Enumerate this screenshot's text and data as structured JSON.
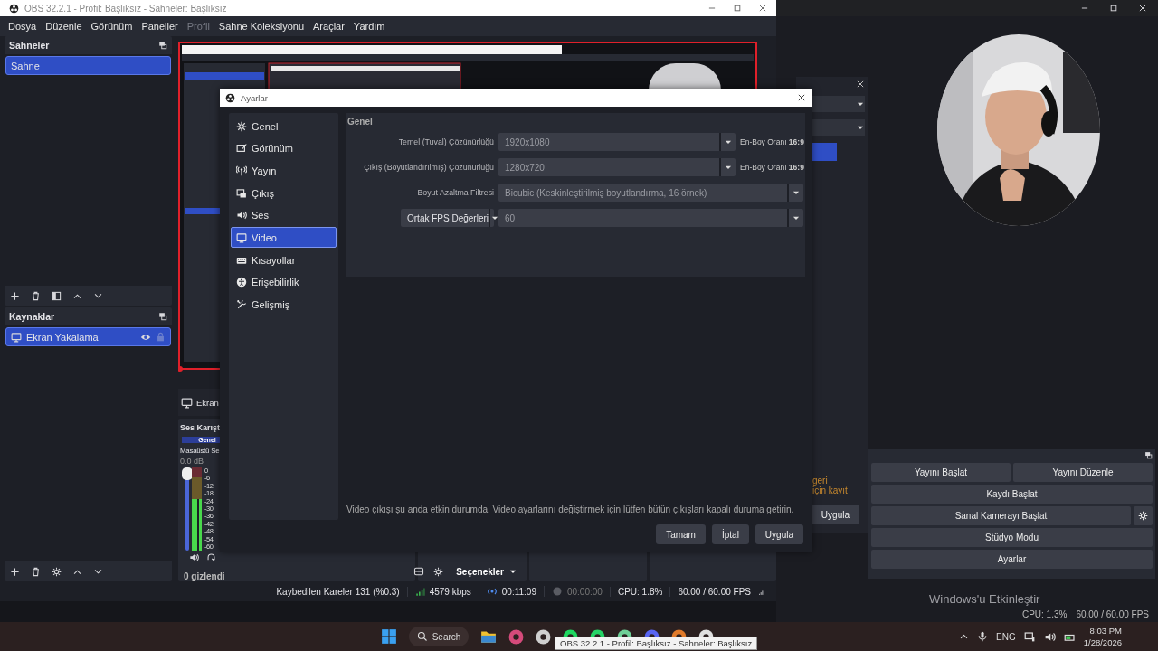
{
  "main_window": {
    "title": "OBS 32.2.1 - Profil: Başlıksız - Sahneler: Başlıksız",
    "menu": [
      {
        "label": "Dosya",
        "disabled": false
      },
      {
        "label": "Düzenle",
        "disabled": false
      },
      {
        "label": "Görünüm",
        "disabled": false
      },
      {
        "label": "Paneller",
        "disabled": false
      },
      {
        "label": "Profil",
        "disabled": true
      },
      {
        "label": "Sahne Koleksiyonu",
        "disabled": false
      },
      {
        "label": "Araçlar",
        "disabled": false
      },
      {
        "label": "Yardım",
        "disabled": false
      }
    ],
    "scenes": {
      "title": "Sahneler",
      "items": [
        {
          "label": "Sahne",
          "selected": true
        }
      ]
    },
    "sources": {
      "title": "Kaynaklar",
      "items": [
        {
          "label": "Ekran Yakalama",
          "selected": true,
          "visible": true,
          "locked": false
        }
      ]
    },
    "source_bar": {
      "label": "Ekran"
    },
    "mixer": {
      "title": "Ses Karışt",
      "tab": "Genel",
      "channel": "Masaüstü Se",
      "reading": "0.0 dB",
      "fader": {
        "level": 1
      },
      "meter": {
        "level": 0.62
      },
      "scale": [
        "0",
        "-6",
        "-12",
        "-18",
        "-24",
        "-30",
        "-36",
        "-42",
        "-48",
        "-54",
        "-60"
      ],
      "hidden_count": "0 gizlendi"
    },
    "transitions": {
      "options": "Seçenekler"
    },
    "status_bar": {
      "dropped": "Kaybedilen Kareler 131 (%0.3)",
      "bitrate": "4579 kbps",
      "streaming": true,
      "stream_time": "00:11:09",
      "recording": false,
      "record_time": "00:00:00",
      "cpu": "CPU: 1.8%",
      "fps": "60.00 / 60.00 FPS"
    }
  },
  "settings_dialog": {
    "title": "Ayarlar",
    "nav": [
      {
        "label": "Genel",
        "selected": false
      },
      {
        "label": "Görünüm",
        "selected": false
      },
      {
        "label": "Yayın",
        "selected": false
      },
      {
        "label": "Çıkış",
        "selected": false
      },
      {
        "label": "Ses",
        "selected": false
      },
      {
        "label": "Video",
        "selected": true
      },
      {
        "label": "Kısayollar",
        "selected": false
      },
      {
        "label": "Erişebilirlik",
        "selected": false
      },
      {
        "label": "Gelişmiş",
        "selected": false
      }
    ],
    "section": "Genel",
    "fields": [
      {
        "kind": "combo",
        "label": "Temel (Tuval) Çözünürlüğü",
        "value": "1920x1080",
        "aspect": "En-Boy Oranı **16:9**",
        "disabled": true
      },
      {
        "kind": "combo",
        "label": "Çıkış (Boyutlandırılmış) Çözünürlüğü",
        "value": "1280x720",
        "aspect": "En-Boy Oranı **16:9**",
        "disabled": true
      },
      {
        "kind": "wide",
        "label": "Boyut Azaltma Filtresi",
        "value": "Bicubic (Keskinleştirilmiş boyutlandırma, 16 örnek)",
        "disabled": true
      },
      {
        "kind": "fps",
        "mode": "Ortak FPS Değerleri",
        "value": "60",
        "disabled": true
      }
    ],
    "notice": "Video çıkışı şu anda etkin durumda. Video ayarlarını değiştirmek için lütfen bütün çıkışları kapalı duruma getirin.",
    "buttons": [
      "Tamam",
      "İptal",
      "Uygula"
    ]
  },
  "background_window": {
    "dialog": {
      "notice_lines": [
        "geri",
        "için kayıt"
      ],
      "button": "Uygula"
    },
    "controls": [
      {
        "kind": "half",
        "label": "Yayını Başlat"
      },
      {
        "kind": "half",
        "label": "Yayını Düzenle"
      },
      {
        "kind": "full",
        "label": "Kaydı Başlat"
      },
      {
        "kind": "with_settings",
        "label": "Sanal Kamerayı Başlat"
      },
      {
        "kind": "full",
        "label": "Stüdyo Modu"
      },
      {
        "kind": "full",
        "label": "Ayarlar"
      }
    ],
    "status_bar": {
      "cpu": "CPU: 1.3%",
      "fps": "60.00 / 60.00 FPS"
    }
  },
  "activation_notice": "Windows'u Etkinleştir",
  "taskbar": {
    "search": "Search",
    "language": "ENG",
    "time": "8:03 PM",
    "date": "1/28/2026",
    "tooltip": "OBS 32.2.1 - Profil: Başlıksız - Sahneler: Başlıksız"
  }
}
